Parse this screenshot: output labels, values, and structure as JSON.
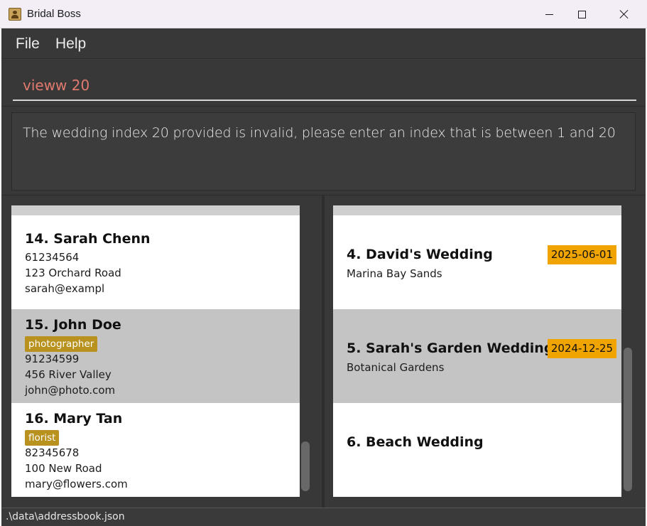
{
  "window": {
    "title": "Bridal Boss"
  },
  "menu": {
    "file_label": "File",
    "help_label": "Help"
  },
  "command": {
    "value": "vieww 20"
  },
  "result": {
    "message": "The wedding index 20 provided is invalid, please enter an index that is between 1 and 20"
  },
  "persons": [
    {
      "name": "14. Sarah Chenn",
      "tag": "",
      "phone": "61234564",
      "address": "123 Orchard Road",
      "email": "sarah@exampl",
      "selected": false
    },
    {
      "name": "15. John Doe",
      "tag": "photographer",
      "phone": "91234599",
      "address": "456 River Valley",
      "email": "john@photo.com",
      "selected": true
    },
    {
      "name": "16. Mary Tan",
      "tag": "florist",
      "phone": "82345678",
      "address": "100 New Road",
      "email": "mary@flowers.com",
      "selected": false
    }
  ],
  "weddings": [
    {
      "name": "4. David's Wedding",
      "venue": "Marina Bay Sands",
      "date": "2025-06-01",
      "selected": false
    },
    {
      "name": "5. Sarah's Garden Wedding",
      "venue": "Botanical Gardens",
      "date": "2024-12-25",
      "selected": true
    },
    {
      "name": "6. Beach Wedding",
      "venue": "",
      "date": "",
      "selected": false
    }
  ],
  "status": {
    "path": ".\\data\\addressbook.json"
  }
}
